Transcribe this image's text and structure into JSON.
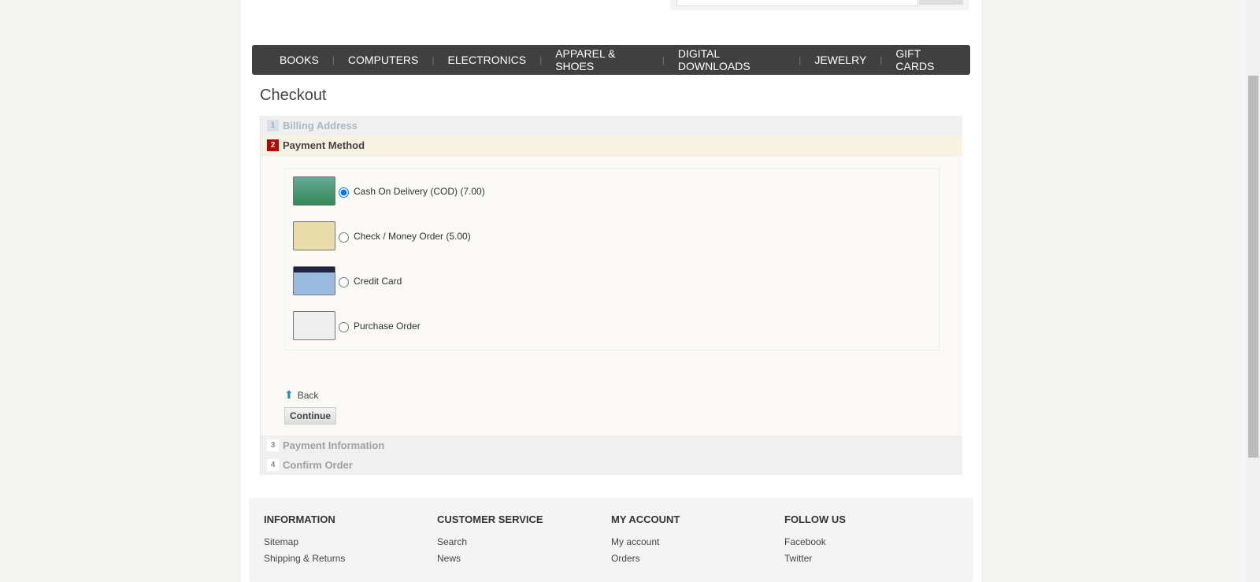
{
  "nav": [
    "BOOKS",
    "COMPUTERS",
    "ELECTRONICS",
    "APPAREL & SHOES",
    "DIGITAL DOWNLOADS",
    "JEWELRY",
    "GIFT CARDS"
  ],
  "title": "Checkout",
  "steps": [
    {
      "n": "1",
      "label": "Billing Address"
    },
    {
      "n": "2",
      "label": "Payment Method"
    },
    {
      "n": "3",
      "label": "Payment Information"
    },
    {
      "n": "4",
      "label": "Confirm Order"
    }
  ],
  "methods": [
    "Cash On Delivery (COD) (7.00)",
    "Check / Money Order (5.00)",
    "Credit Card",
    "Purchase Order"
  ],
  "back": "Back",
  "continue": "Continue",
  "footer": [
    {
      "h": "INFORMATION",
      "l": [
        "Sitemap",
        "Shipping & Returns"
      ]
    },
    {
      "h": "CUSTOMER SERVICE",
      "l": [
        "Search",
        "News"
      ]
    },
    {
      "h": "MY ACCOUNT",
      "l": [
        "My account",
        "Orders"
      ]
    },
    {
      "h": "FOLLOW US",
      "l": [
        "Facebook",
        "Twitter"
      ]
    }
  ]
}
